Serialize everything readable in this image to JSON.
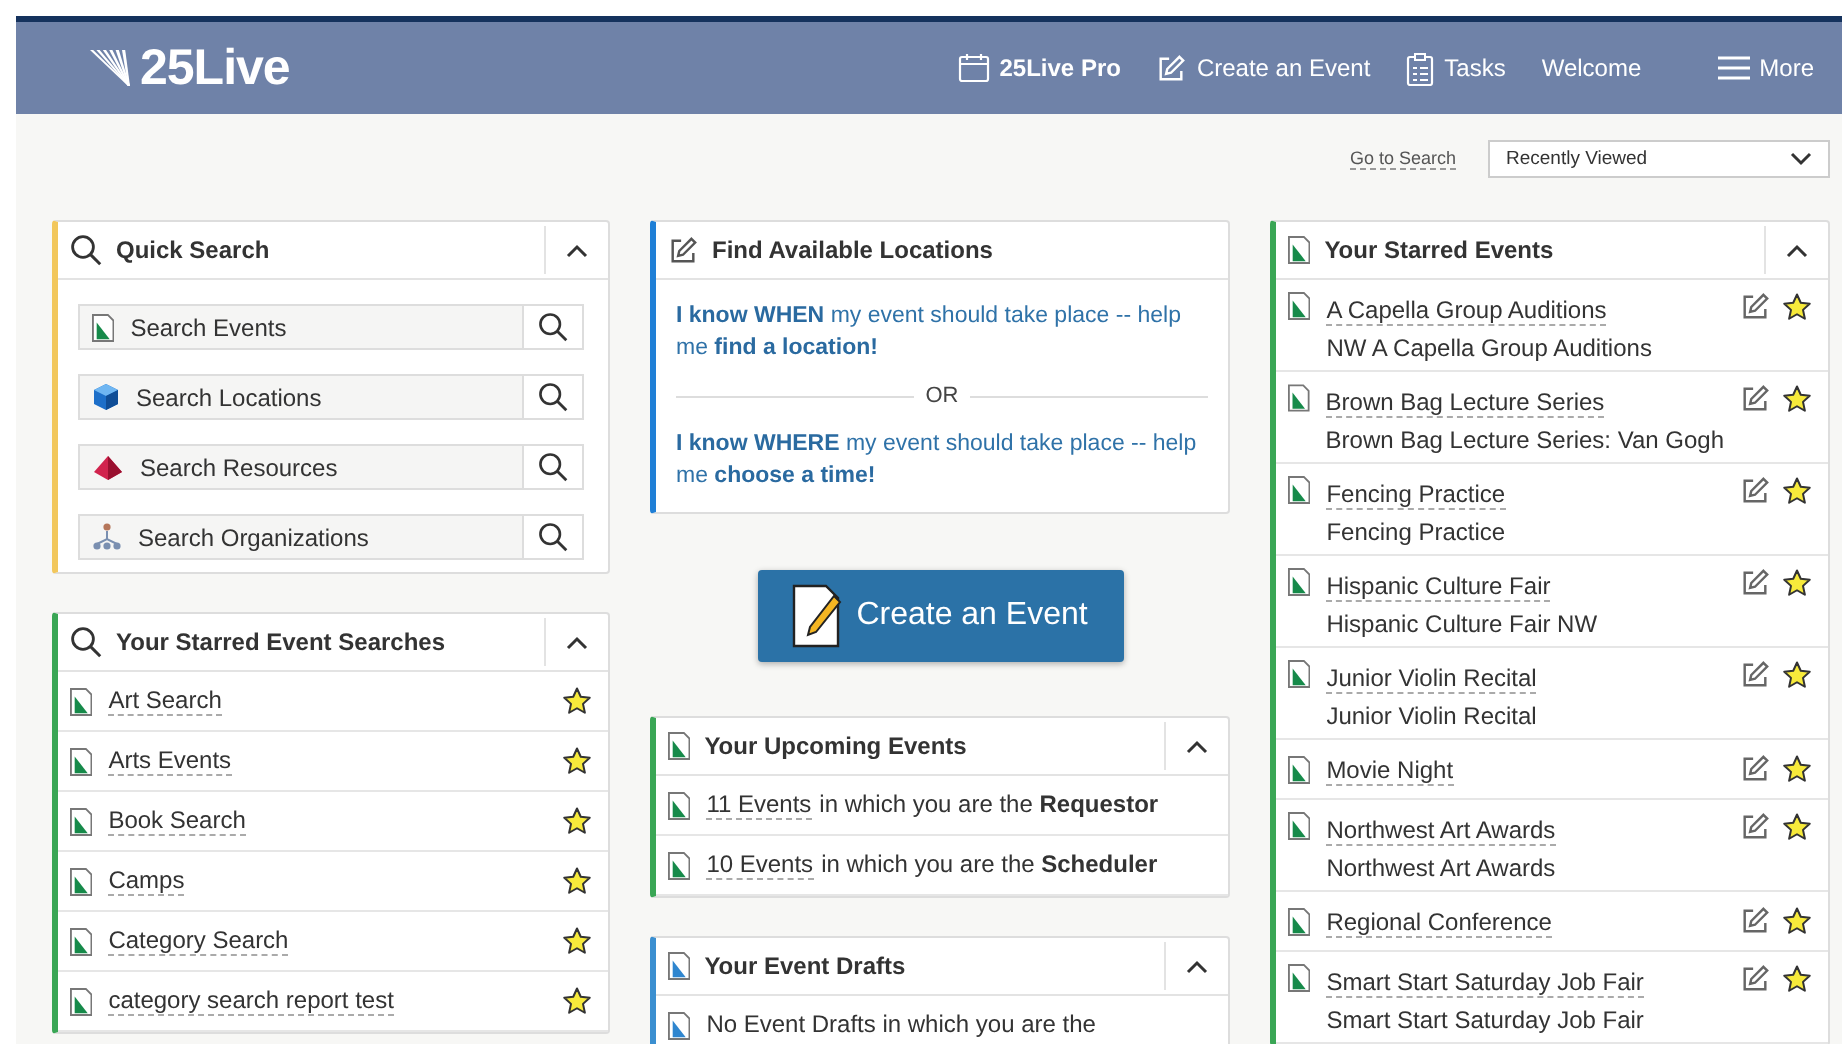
{
  "header": {
    "logo": "25Live",
    "nav": [
      {
        "kind": "pro",
        "label": "25Live Pro"
      },
      {
        "kind": "create",
        "label": "Create an Event"
      },
      {
        "kind": "tasks",
        "label": "Tasks"
      },
      {
        "kind": "plain",
        "label": "Welcome"
      },
      {
        "kind": "menu",
        "label": "More"
      }
    ]
  },
  "subbar": {
    "link": "Go to Search",
    "select": {
      "value": "Recently Viewed"
    }
  },
  "quick_search": {
    "title": "Quick Search",
    "color": "#f2c75c",
    "expanded": true,
    "items": [
      {
        "kind": "events",
        "placeholder": "Search Events"
      },
      {
        "kind": "locations",
        "placeholder": "Search Locations"
      },
      {
        "kind": "resources",
        "placeholder": "Search Resources"
      },
      {
        "kind": "organizations",
        "placeholder": "Search Organizations"
      }
    ]
  },
  "starred_searches": {
    "title": "Your Starred Event Searches",
    "color": "#3aa655",
    "expanded": true,
    "items": [
      {
        "label": "Art Search",
        "starred": true
      },
      {
        "label": "Arts Events",
        "starred": true
      },
      {
        "label": "Book Search",
        "starred": true
      },
      {
        "label": "Camps",
        "starred": true
      },
      {
        "label": "Category Search",
        "starred": true
      },
      {
        "label": "category search report test",
        "starred": true
      }
    ]
  },
  "find_locations": {
    "title": "Find Available Locations",
    "color": "#1f7fd6",
    "options": [
      "**I know WHEN** my event should take place -- help me **find a location!**",
      "**I know WHERE** my event should take place -- help me **choose a time!**"
    ],
    "separator": "OR"
  },
  "create_button": {
    "label": "Create an Event"
  },
  "upcoming": {
    "title": "Your Upcoming Events",
    "color": "#3aa655",
    "expanded": true,
    "items": [
      {
        "link": "11 Events",
        "text": "in which you are the **Requestor**"
      },
      {
        "link": "10 Events",
        "text": "in which you are the **Scheduler**"
      }
    ]
  },
  "drafts": {
    "title": "Your Event Drafts",
    "color": "#3b8fd0",
    "expanded": true,
    "items": [
      {
        "text": "No Event Drafts in which you are the"
      }
    ]
  },
  "starred_events": {
    "title": "Your Starred Events",
    "color": "#3aa655",
    "expanded": true,
    "items": [
      {
        "name": "A Capella Group Auditions",
        "detail": "NW A Capella Group Auditions",
        "starred": true
      },
      {
        "name": "Brown Bag Lecture Series",
        "detail": "Brown Bag Lecture Series: Van Gogh",
        "starred": true
      },
      {
        "name": "Fencing Practice",
        "detail": "Fencing Practice",
        "starred": true
      },
      {
        "name": "Hispanic Culture Fair",
        "detail": "Hispanic Culture Fair NW",
        "starred": true
      },
      {
        "name": "Junior Violin Recital",
        "detail": "Junior Violin Recital",
        "starred": true
      },
      {
        "name": "Movie Night",
        "starred": true
      },
      {
        "name": "Northwest Art Awards",
        "detail": "Northwest Art Awards",
        "starred": true
      },
      {
        "name": "Regional Conference",
        "starred": true
      },
      {
        "name": "Smart Start Saturday Job Fair",
        "detail": "Smart Start Saturday Job Fair",
        "starred": true
      }
    ]
  }
}
